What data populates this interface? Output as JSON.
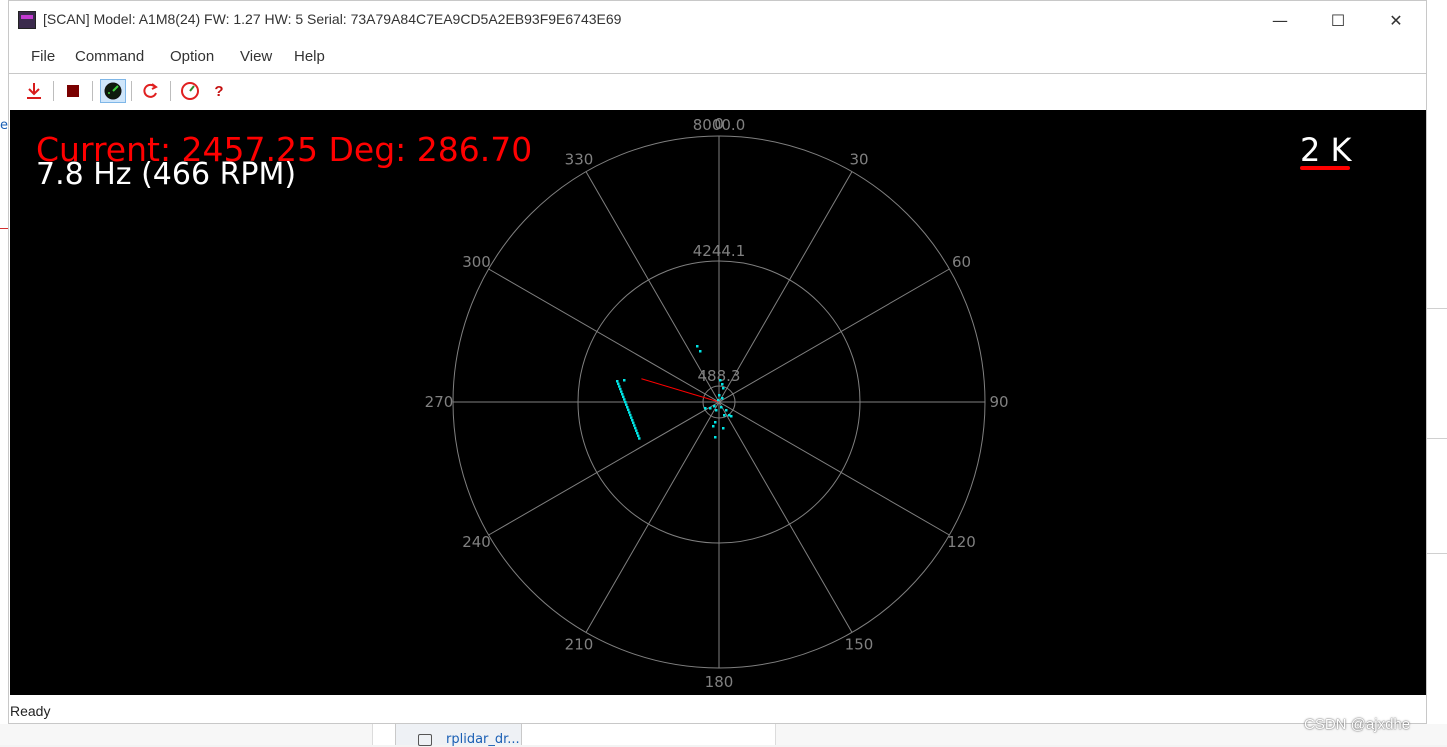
{
  "window": {
    "title": "[SCAN] Model: A1M8(24) FW: 1.27 HW: 5 Serial: 73A79A84C7EA9CD5A2EB93F9E6743E69",
    "minimize": "—",
    "maximize": "☐",
    "close": "✕"
  },
  "menu": {
    "file": "File",
    "command": "Command",
    "option": "Option",
    "view": "View",
    "help": "Help"
  },
  "toolbar": {
    "help_label": "?",
    "icons": [
      "download-icon",
      "stop-icon",
      "radar-icon",
      "refresh-icon",
      "gauge-icon",
      "help-icon"
    ]
  },
  "scan": {
    "current_text": "Current: 2457.25 Deg: 286.70",
    "freq_text": "7.8 Hz (466 RPM)",
    "scale_text": "2 K",
    "ring_labels": [
      "8000.0",
      "4244.1",
      "488.3"
    ],
    "angle_labels": [
      "0",
      "30",
      "60",
      "90",
      "120",
      "150",
      "180",
      "210",
      "240",
      "270",
      "300",
      "330"
    ],
    "colors": {
      "background": "#000000",
      "grid": "#808080",
      "points": "#00e5e5",
      "current": "#ff0000"
    }
  },
  "status": {
    "text": "Ready"
  },
  "background": {
    "bottom_text": "rplidar_dr...",
    "left_text": "e",
    "watermark": "CSDN @ajxdhe"
  }
}
